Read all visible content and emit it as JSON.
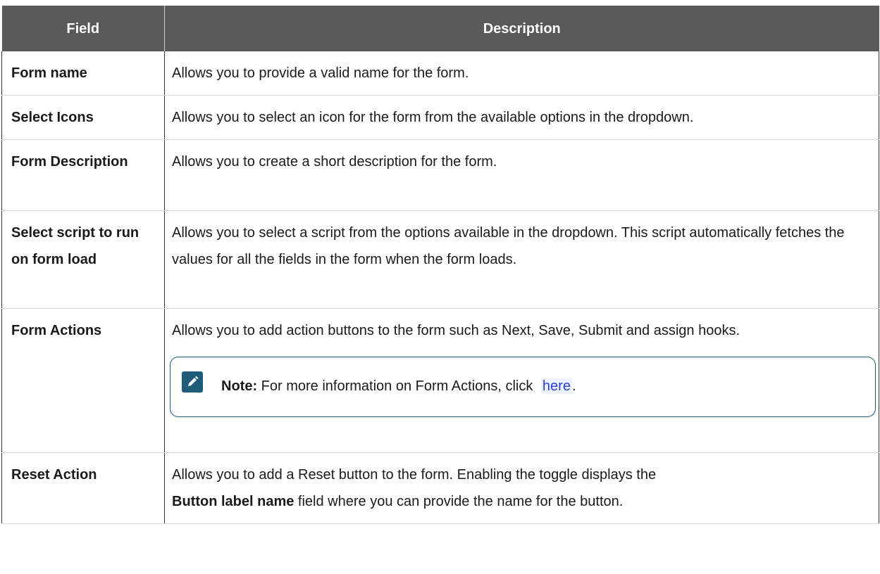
{
  "table": {
    "headers": {
      "field": "Field",
      "description": "Description"
    },
    "rows": [
      {
        "field": "Form name",
        "description": "Allows you to provide a valid name for the form."
      },
      {
        "field": "Select Icons",
        "description": "Allows you to select an icon for the form from the available options in the dropdown."
      },
      {
        "field": "Form Description",
        "description": "Allows you to create a short description for the form."
      },
      {
        "field": "Select script to run on form load",
        "description": "Allows you to select a script from the options available in the dropdown. This script automatically fetches the values for all the fields in the form when the form loads."
      },
      {
        "field": "Form Actions",
        "description": "Allows you to add action buttons to the form such as Next, Save, Submit and assign hooks.",
        "note": {
          "icon": "pencil-note-icon",
          "label": "Note:",
          "text": "For more information on Form Actions, click",
          "link_text": "here",
          "trailing": "."
        }
      },
      {
        "field": "Reset Action",
        "description_part1": "Allows you to add a Reset button to the form. Enabling the toggle displays the",
        "description_bold": "Button label name",
        "description_part2": "field where you can provide the name for the button."
      }
    ]
  },
  "colors": {
    "header_bg": "#595959",
    "note_border": "#1e5c7a",
    "link": "#2b3fd6"
  }
}
